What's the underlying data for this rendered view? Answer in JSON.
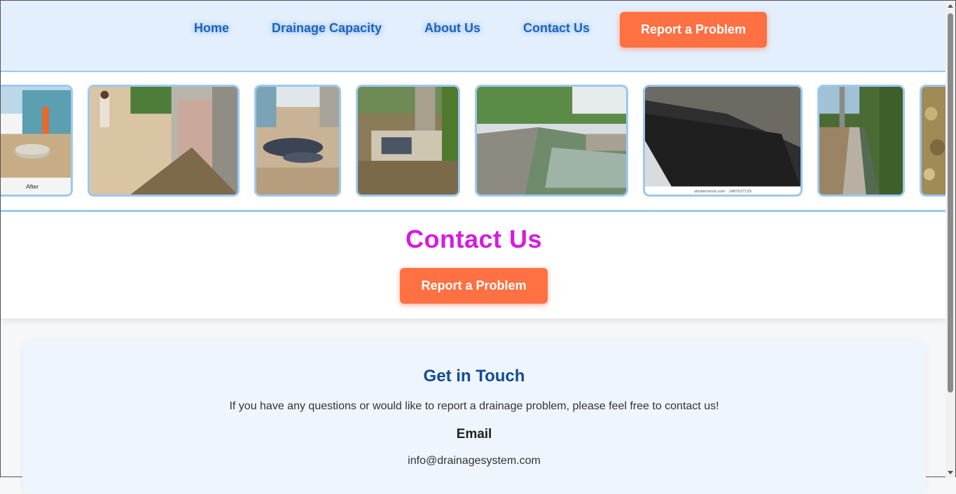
{
  "nav": {
    "home": "Home",
    "drainage_capacity": "Drainage Capacity",
    "about": "About Us",
    "contact": "Contact Us",
    "report": "Report a Problem"
  },
  "gallery": {
    "caption_first": "After",
    "caption_stock": "shutterstock.com · 1487627129"
  },
  "contact": {
    "title": "Contact Us",
    "report": "Report a Problem"
  },
  "card": {
    "heading": "Get in Touch",
    "intro": "If you have any questions or would like to report a drainage problem, please feel free to contact us!",
    "email_label": "Email",
    "email": "info@drainagesystem.com"
  },
  "colors": {
    "accent": "#ff7043",
    "nav_link": "#1d63c0",
    "title": "#d61be0",
    "card_heading": "#124b95"
  }
}
